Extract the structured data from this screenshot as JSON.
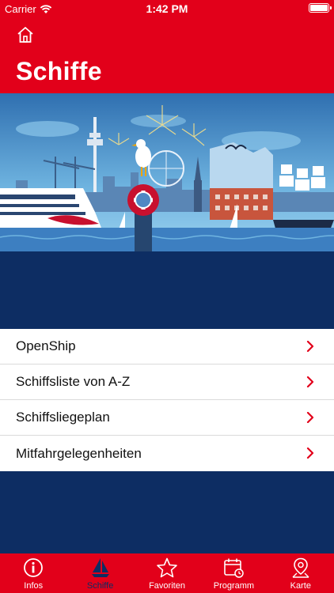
{
  "status_bar": {
    "carrier": "Carrier",
    "time": "1:42 PM"
  },
  "header": {
    "title": "Schiffe"
  },
  "hero": {
    "icon": "harbor-skyline-illustration"
  },
  "menu": {
    "items": [
      {
        "label": "OpenShip"
      },
      {
        "label": "Schiffsliste von A-Z"
      },
      {
        "label": "Schiffsliegeplan"
      },
      {
        "label": "Mitfahrgelegenheiten"
      }
    ]
  },
  "tabbar": {
    "tabs": [
      {
        "label": "Infos",
        "icon": "info-icon",
        "active": false
      },
      {
        "label": "Schiffe",
        "icon": "sailboat-icon",
        "active": true
      },
      {
        "label": "Favoriten",
        "icon": "star-icon",
        "active": false
      },
      {
        "label": "Programm",
        "icon": "calendar-icon",
        "active": false
      },
      {
        "label": "Karte",
        "icon": "map-pin-icon",
        "active": false
      }
    ]
  },
  "colors": {
    "brand_red": "#e2001a",
    "navy": "#0d2d63",
    "chevron": "#e2001a"
  }
}
